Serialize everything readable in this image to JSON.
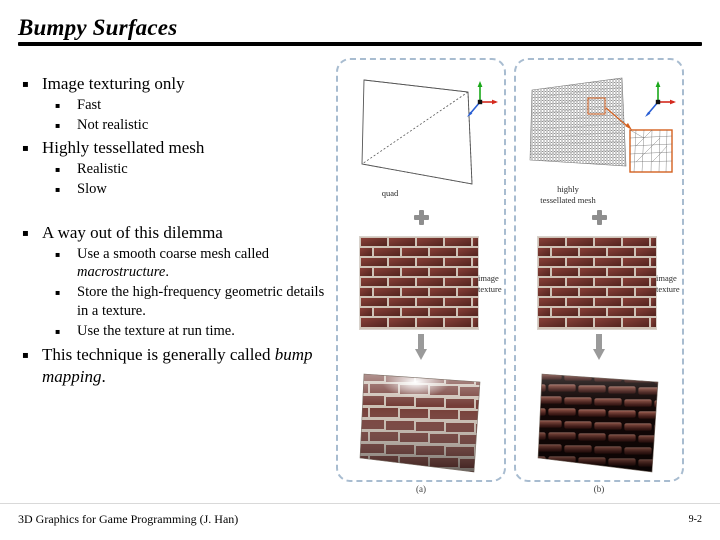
{
  "slide": {
    "title": "Bumpy Surfaces",
    "footer_text": "3D Graphics for Game Programming (J. Han)",
    "page_number": "9-2"
  },
  "bullets": [
    {
      "level": 1,
      "text": "Image texturing only"
    },
    {
      "level": 2,
      "text": "Fast"
    },
    {
      "level": 2,
      "text": "Not realistic"
    },
    {
      "level": 1,
      "text": "Highly tessellated mesh"
    },
    {
      "level": 2,
      "text": "Realistic"
    },
    {
      "level": 2,
      "text": "Slow"
    },
    {
      "level": 1,
      "text": "A way out of this dilemma"
    },
    {
      "level": 2,
      "text": "Use a smooth coarse mesh called ",
      "italic_tail": "macrostructure",
      "tail_end": "."
    },
    {
      "level": 2,
      "text": "Store the high-frequency geometric details in a texture."
    },
    {
      "level": 2,
      "text": "Use the texture at run time."
    },
    {
      "level": 1,
      "text": "This technique is generally called ",
      "italic_tail": "bump mapping",
      "tail_end": "."
    }
  ],
  "bullet_text": {
    "item1": "Image texturing only",
    "item2": "Fast",
    "item3": "Not realistic",
    "item4": "Highly tessellated mesh",
    "item5": "Realistic",
    "item6": "Slow",
    "item7": "A way out of this dilemma",
    "item8_lead": "Use a smooth coarse mesh called ",
    "item8_italic": "macrostructure",
    "item8_end": ".",
    "item9": "Store the high-frequency geometric details in a texture.",
    "item10": "Use the texture at run time.",
    "item11_lead": "This technique is generally called ",
    "item11_italic": "bump mapping",
    "item11_end": "."
  },
  "bullet_marker": "▪",
  "figure": {
    "panel_a": {
      "caption": "(a)",
      "geometry_label": "quad",
      "texture_label_line1": "image",
      "texture_label_line2": "texture",
      "plus_symbol": "+",
      "axis_x": "x",
      "axis_y": "y",
      "axis_z": "z"
    },
    "panel_b": {
      "caption": "(b)",
      "geometry_label_line1": "highly",
      "geometry_label_line2": "tessellated mesh",
      "texture_label_line1": "image",
      "texture_label_line2": "texture",
      "plus_symbol": "+",
      "axis_x": "x",
      "axis_y": "y",
      "axis_z": "z"
    }
  },
  "colors": {
    "axis_x": "#d42a1e",
    "axis_y": "#1aa81a",
    "axis_z": "#2a5fd4",
    "panel_border": "#a8bcd0",
    "callout": "#d4601f",
    "arrow_gray": "#9a9a9a",
    "brick_dark": "#5a2a26",
    "brick_mid": "#7b3a33",
    "mortar": "#d8cfc6"
  }
}
